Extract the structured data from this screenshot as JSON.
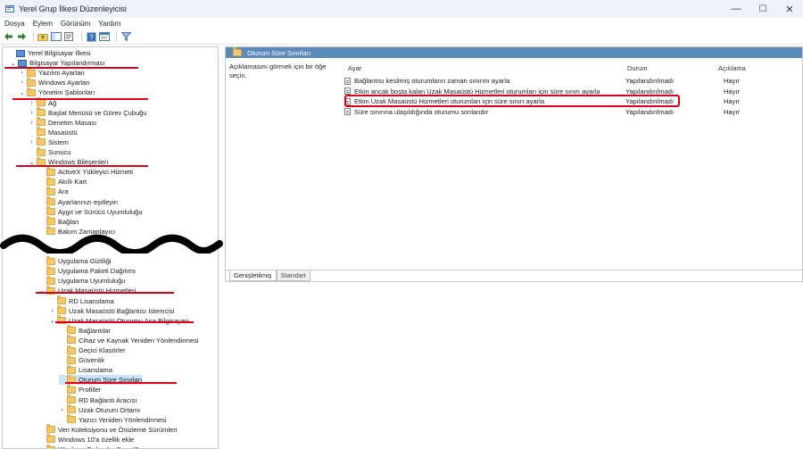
{
  "window": {
    "title": "Yerel Grup İlkesi Düzenleyicisi",
    "minimize": "—",
    "maximize": "☐",
    "close": "✕"
  },
  "menu": [
    {
      "label": "Dosya"
    },
    {
      "label": "Eylem"
    },
    {
      "label": "Görünüm"
    },
    {
      "label": "Yardım"
    }
  ],
  "toolbar": {
    "icons": [
      "back-arrow-icon",
      "forward-arrow-icon",
      "folder-up-icon",
      "show-hide-tree-icon",
      "export-icon",
      "help-icon",
      "properties-icon",
      "filter-icon"
    ]
  },
  "tree": {
    "items": [
      {
        "label": "Yerel Bilgisayar İlkesi",
        "level": 0,
        "chevron": "",
        "icon": "computer"
      },
      {
        "label": "Bilgisayar Yapılandırması",
        "level": 1,
        "chevron": "v",
        "icon": "computer"
      },
      {
        "label": "Yazılım Ayarları",
        "level": 2,
        "chevron": ">",
        "icon": "folder"
      },
      {
        "label": "Windows Ayarları",
        "level": 2,
        "chevron": ">",
        "icon": "folder"
      },
      {
        "label": "Yönetim Şablonları",
        "level": 2,
        "chevron": "v",
        "icon": "folder"
      },
      {
        "label": "Ağ",
        "level": 3,
        "chevron": ">",
        "icon": "folder"
      },
      {
        "label": "Başlat Menüsü ve Görev Çubuğu",
        "level": 3,
        "chevron": ">",
        "icon": "folder"
      },
      {
        "label": "Denetim Masası",
        "level": 3,
        "chevron": ">",
        "icon": "folder"
      },
      {
        "label": "Masaüstü",
        "level": 3,
        "chevron": "",
        "icon": "folder"
      },
      {
        "label": "Sistem",
        "level": 3,
        "chevron": ">",
        "icon": "folder"
      },
      {
        "label": "Sunucu",
        "level": 3,
        "chevron": "",
        "icon": "folder"
      },
      {
        "label": "Windows Bileşenleri",
        "level": 3,
        "chevron": "v",
        "icon": "folder"
      },
      {
        "label": "ActiveX Yükleyici Hizmeti",
        "level": 4,
        "chevron": "",
        "icon": "folder"
      },
      {
        "label": "Akıllı Kart",
        "level": 4,
        "chevron": "",
        "icon": "folder"
      },
      {
        "label": "Ara",
        "level": 4,
        "chevron": "",
        "icon": "folder"
      },
      {
        "label": "Ayarlarınızı eşitleyin",
        "level": 4,
        "chevron": "",
        "icon": "folder"
      },
      {
        "label": "Aygıt ve Sürücü Uyumluluğu",
        "level": 4,
        "chevron": "",
        "icon": "folder"
      },
      {
        "label": "Bağlan",
        "level": 4,
        "chevron": "",
        "icon": "folder"
      },
      {
        "label": "Bakım Zamanlayıcı",
        "level": 4,
        "chevron": "",
        "icon": "folder"
      },
      {
        "label": "Uygulama Gizliliği",
        "level": 4,
        "chevron": "",
        "icon": "folder"
      },
      {
        "label": "Uygulama Paketi Dağıtımı",
        "level": 4,
        "chevron": "",
        "icon": "folder"
      },
      {
        "label": "Uygulama Uyumluluğu",
        "level": 4,
        "chevron": "",
        "icon": "folder"
      },
      {
        "label": "Uzak Masaüstü Hizmetleri",
        "level": 4,
        "chevron": "v",
        "icon": "folder"
      },
      {
        "label": "RD Lisanslama",
        "level": 5,
        "chevron": "",
        "icon": "folder"
      },
      {
        "label": "Uzak Masaüstü Bağlantısı İstemcisi",
        "level": 5,
        "chevron": ">",
        "icon": "folder"
      },
      {
        "label": "Uzak Masaüstü Oturumu Ana Bilgisayarı",
        "level": 5,
        "chevron": "v",
        "icon": "folder"
      },
      {
        "label": "Bağlantılar",
        "level": 6,
        "chevron": "",
        "icon": "folder"
      },
      {
        "label": "Cihaz ve Kaynak Yeniden Yönlendirmesi",
        "level": 6,
        "chevron": "",
        "icon": "folder"
      },
      {
        "label": "Geçici Klasörler",
        "level": 6,
        "chevron": "",
        "icon": "folder"
      },
      {
        "label": "Güvenlik",
        "level": 6,
        "chevron": "",
        "icon": "folder"
      },
      {
        "label": "Lisanslama",
        "level": 6,
        "chevron": "",
        "icon": "folder"
      },
      {
        "label": "Oturum Süre Sınırları",
        "level": 6,
        "chevron": "",
        "icon": "folder",
        "selected": true
      },
      {
        "label": "Profiller",
        "level": 6,
        "chevron": "",
        "icon": "folder"
      },
      {
        "label": "RD Bağlantı Aracısı",
        "level": 6,
        "chevron": "",
        "icon": "folder"
      },
      {
        "label": "Uzak Oturum Ortamı",
        "level": 6,
        "chevron": ">",
        "icon": "folder"
      },
      {
        "label": "Yazıcı Yeniden Yönlendirmesi",
        "level": 6,
        "chevron": "",
        "icon": "folder"
      },
      {
        "label": "Veri Koleksiyonu ve Önizleme Sürümleri",
        "level": 4,
        "chevron": "",
        "icon": "folder"
      },
      {
        "label": "Windows 10'a özellik ekle",
        "level": 4,
        "chevron": "",
        "icon": "folder"
      },
      {
        "label": "Windows Defender SmartScreen",
        "level": 4,
        "chevron": ">",
        "icon": "folder"
      }
    ]
  },
  "right_pane": {
    "header": "Oturum Süre Sınırları",
    "description": "Açıklamasını görmek için bir öğe seçin.",
    "columns": [
      "Ayar",
      "Durum",
      "Açıklama"
    ],
    "rows": [
      {
        "setting": "Bağlantısı kesilmiş oturumların zaman sınırını ayarla",
        "state": "Yapılandırılmadı",
        "comment": "Hayır"
      },
      {
        "setting": "Etkin ancak boşta kalan Uzak Masaüstü Hizmetleri oturumları için süre sınırı ayarla",
        "state": "Yapılandırılmadı",
        "comment": "Hayır"
      },
      {
        "setting": "Etkin Uzak Masaüstü Hizmetleri oturumları için süre sınırı ayarla",
        "state": "Yapılandırılmadı",
        "comment": "Hayır"
      },
      {
        "setting": "Süre sınırına ulaşıldığında oturumu sonlandır",
        "state": "Yapılandırılmadı",
        "comment": "Hayır"
      }
    ],
    "tabs": [
      "Genişletilmiş",
      "Standart"
    ]
  },
  "colors": {
    "header_blue": "#5b8bbd",
    "annotation_red": "#e0001a",
    "selection": "#cce4f7"
  }
}
